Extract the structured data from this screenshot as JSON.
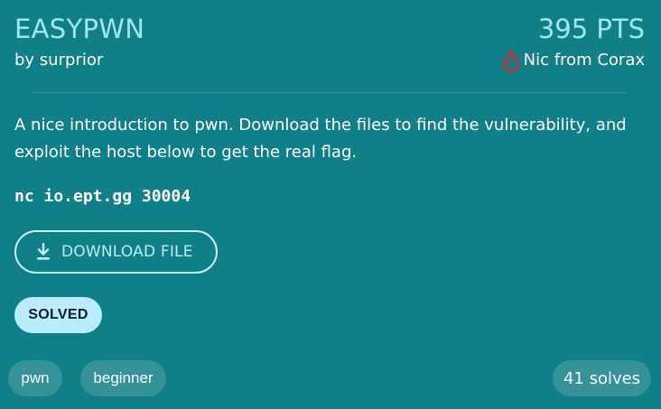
{
  "challenge": {
    "title": "EASYPWN",
    "author": "by surprior",
    "points": "395 PTS",
    "first_blood": {
      "icon": "blood-drop-icon",
      "name": "Nic from Corax",
      "icon_color": "#e3262e"
    },
    "description": "A nice introduction to pwn. Download the files to find the vulnerability, and exploit the host below to get the real flag.",
    "connection_command": "nc io.ept.gg 30004",
    "download_button": {
      "icon": "download-icon",
      "label": "DOWNLOAD FILE"
    },
    "status_badge": "SOLVED",
    "tags": [
      "pwn",
      "beginner"
    ],
    "solves": "41 solves"
  },
  "colors": {
    "background": "#117f87",
    "accent": "#9fe6f0",
    "badge": "#b8ebfb"
  }
}
